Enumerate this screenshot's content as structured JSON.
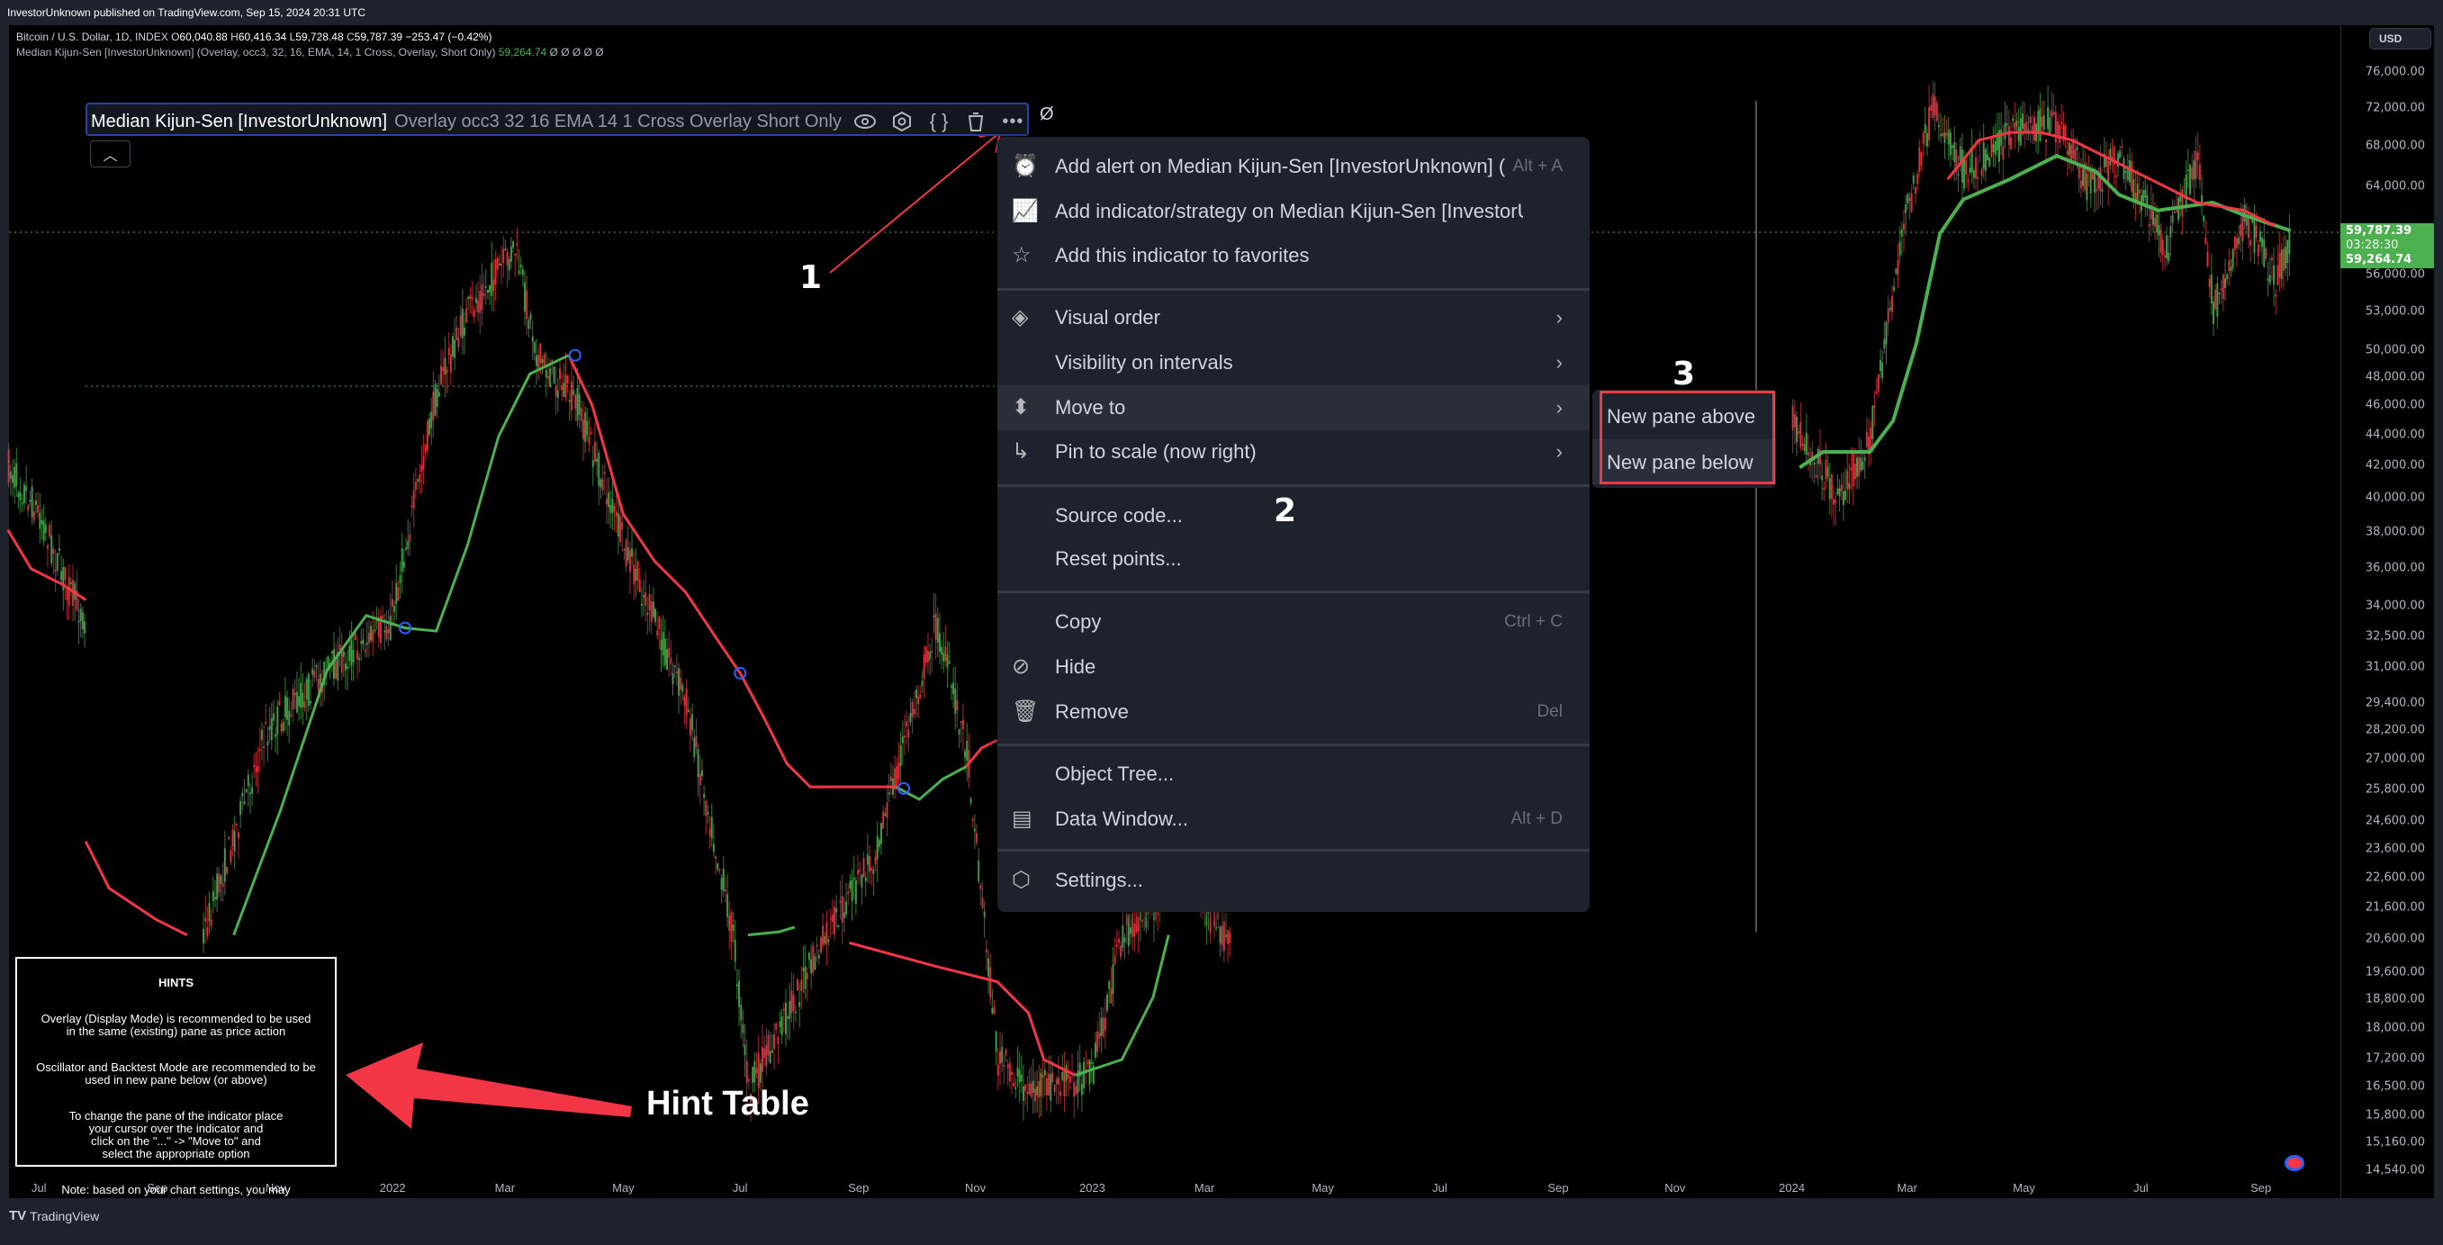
{
  "topbar": {
    "published": "InvestorUnknown published on TradingView.com, Sep 15, 2024 20:31 UTC"
  },
  "legend": {
    "symbol": "Bitcoin / U.S. Dollar, 1D, INDEX",
    "open_label": "O",
    "open": "60,040.88",
    "high_label": "H",
    "high": "60,416.34",
    "low_label": "L",
    "low": "59,728.48",
    "close_label": "C",
    "close": "59,787.39",
    "change": "−253.47 (−0.42%)",
    "indicator_line": "Median Kijun-Sen [InvestorUnknown] (Overlay, occ3, 32, 16, EMA, 14, 1 Cross, Overlay, Short Only)",
    "indicator_value": "59,264.74",
    "indicator_extra": "Ø Ø Ø Ø Ø"
  },
  "indicator_box": {
    "name": "Median Kijun-Sen [InvestorUnknown]",
    "params": "Overlay occ3 32 16 EMA 14 1 Cross Overlay Short Only",
    "trailing": "Ø",
    "icons": [
      "eye-icon",
      "settings-icon",
      "source-code-icon",
      "trash-icon",
      "more-icon"
    ]
  },
  "menu": {
    "items": [
      {
        "label": "Add alert on Median Kijun-Sen [InvestorUnknown] (",
        "shortcut": "Alt + A",
        "icon": "alarm-clock-plus-icon"
      },
      {
        "label": "Add indicator/strategy on Median Kijun-Sen [InvestorUnkn",
        "shortcut": "",
        "icon": "indicator-plus-icon"
      },
      {
        "label": "Add this indicator to favorites",
        "shortcut": "",
        "icon": "star-icon"
      },
      {
        "label": "Visual order",
        "submenu": true,
        "icon": "layers-icon"
      },
      {
        "label": "Visibility on intervals",
        "submenu": true,
        "icon": ""
      },
      {
        "label": "Move to",
        "submenu": true,
        "icon": "move-icon",
        "highlighted": true
      },
      {
        "label": "Pin to scale (now right)",
        "submenu": true,
        "icon": "pin-scale-icon"
      },
      {
        "label": "Source code...",
        "shortcut": ""
      },
      {
        "label": "Reset points...",
        "shortcut": ""
      },
      {
        "label": "Copy",
        "shortcut": "Ctrl + C"
      },
      {
        "label": "Hide",
        "shortcut": "",
        "icon": "hide-eye-icon"
      },
      {
        "label": "Remove",
        "shortcut": "Del",
        "icon": "trash-icon"
      },
      {
        "label": "Object Tree...",
        "shortcut": ""
      },
      {
        "label": "Data Window...",
        "shortcut": "Alt + D",
        "icon": "data-window-icon"
      },
      {
        "label": "Settings...",
        "shortcut": "",
        "icon": "settings-icon"
      }
    ]
  },
  "submenu": {
    "items": [
      "New pane above",
      "New pane below"
    ]
  },
  "annotations": {
    "step1": "1",
    "step2": "2",
    "step3": "3",
    "hint_table": "Hint Table",
    "color": "#f23645"
  },
  "hints": {
    "title": "HINTS",
    "paragraphs": [
      "Overlay (Display Mode) is recommended to be used\nin the same (existing) pane as price action",
      "Oscillator and Backtest Mode are recommended to be\nused in new pane below (or above)",
      "To change the pane of the indicator place\nyour cursor over the indicator and\nclick on the \"...\" -> \"Move to\" and\nselect the appropriate option",
      "Note: based on your chart settings, you may\nor may not need to change the\nscaling of the new pane"
    ]
  },
  "price_axis": {
    "currency": "USD",
    "scale": "log",
    "ticks": [
      "76,000.00",
      "72,000.00",
      "68,000.00",
      "64,000.00",
      "56,000.00",
      "53,000.00",
      "50,000.00",
      "48,000.00",
      "46,000.00",
      "44,000.00",
      "42,000.00",
      "40,000.00",
      "38,000.00",
      "36,000.00",
      "34,000.00",
      "32,500.00",
      "31,000.00",
      "29,400.00",
      "28,200.00",
      "27,000.00",
      "25,800.00",
      "24,600.00",
      "23,600.00",
      "22,600.00",
      "21,600.00",
      "20,600.00",
      "19,600.00",
      "18,800.00",
      "18,000.00",
      "17,200.00",
      "16,500.00",
      "15,800.00",
      "15,160.00",
      "14,540.00"
    ],
    "last_price": "59,787.39",
    "countdown": "03:28:30",
    "indicator_price": "59,264.74"
  },
  "time_axis": {
    "labels": [
      "Jul",
      "Sep",
      "Nov",
      "2022",
      "Mar",
      "May",
      "Jul",
      "Sep",
      "Nov",
      "2023",
      "Mar",
      "May",
      "Jul",
      "Sep",
      "Nov",
      "2024",
      "Mar",
      "May",
      "Jul",
      "Sep"
    ]
  },
  "colors": {
    "up": "#4caf50",
    "down": "#f23645",
    "kijun_bull": "#4caf50",
    "kijun_bear": "#f23645",
    "accent": "#2962ff"
  },
  "footer": {
    "brand": "TradingView"
  }
}
